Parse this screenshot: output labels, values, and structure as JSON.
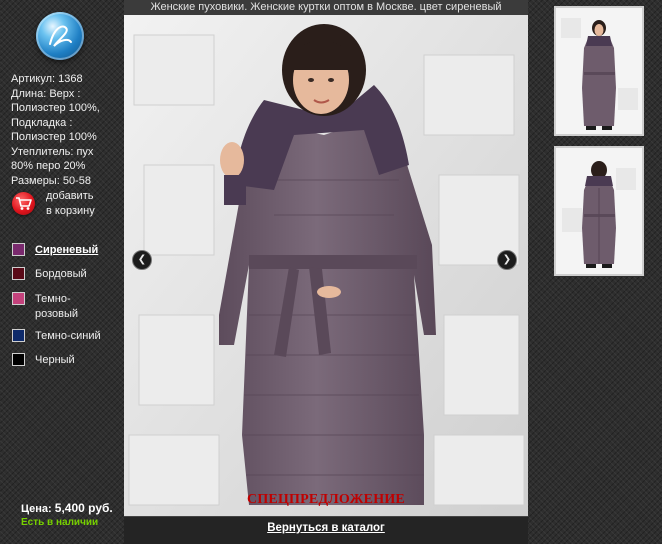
{
  "product": {
    "title": "Женские пуховики. Женские куртки оптом в Москве. цвет сиреневый",
    "info_lines": [
      "Артикул: 1368",
      "Длина: Верх :",
      "Полиэстер 100%,",
      "Подкладка :",
      "Полиэстер 100%",
      "Утеплитель: пух",
      "80% перо 20%",
      "Размеры: 50-58"
    ]
  },
  "cart": {
    "line1": "добавить",
    "line2": "в корзину"
  },
  "colors": [
    {
      "label": "Сиреневый",
      "hex": "#7a2a6e",
      "selected": true
    },
    {
      "label": "Бордовый",
      "hex": "#5a0a18"
    },
    {
      "label": "Темно-",
      "label2": "розовый",
      "hex": "#c4427c"
    },
    {
      "label": "Темно-синий",
      "hex": "#0e2a6a"
    },
    {
      "label": "Черный",
      "hex": "#000000"
    }
  ],
  "price": {
    "label": "Цена:",
    "value": "5,400 руб."
  },
  "stock": "Есть в наличии",
  "promo": "СПЕЦПРЕДЛОЖЕНИЕ",
  "back_link": "Вернуться в каталог",
  "nav": {
    "prev_icon": "chevron-left-icon",
    "next_icon": "chevron-right-icon"
  },
  "theme": {
    "coat": "#6e5c6c",
    "fur": "#4a3a52",
    "accent_stock": "#77d100",
    "promo": "#c00000"
  }
}
